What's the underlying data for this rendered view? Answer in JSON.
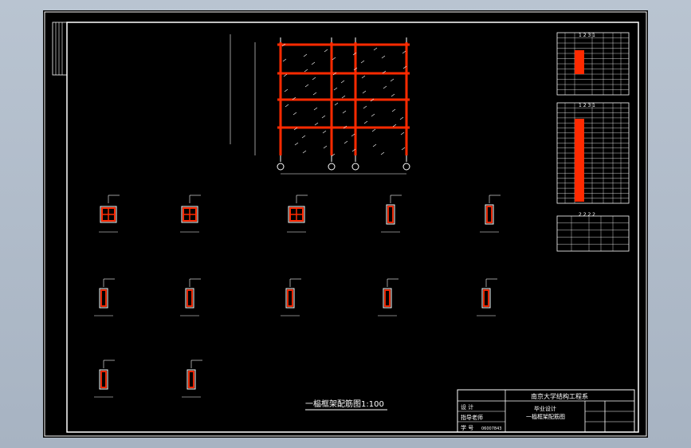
{
  "drawing_title": "一榀框架配筋图1:100",
  "title_block": {
    "school": "南京大学结构工程系",
    "project": "毕业设计",
    "drawing_name": "一榀框架配筋图",
    "rows": [
      "设 计",
      "指导老师",
      "学 号"
    ],
    "student_no": "06007843"
  },
  "tables": {
    "t1_title": "1 2 3 1",
    "t2_title": "1 2 3 1",
    "t3_title": "2 2 2 2"
  },
  "colors": {
    "background": "#000000",
    "frame": "#ffffff",
    "rebar": "#ff2a00",
    "accent": "#ffcc00"
  }
}
